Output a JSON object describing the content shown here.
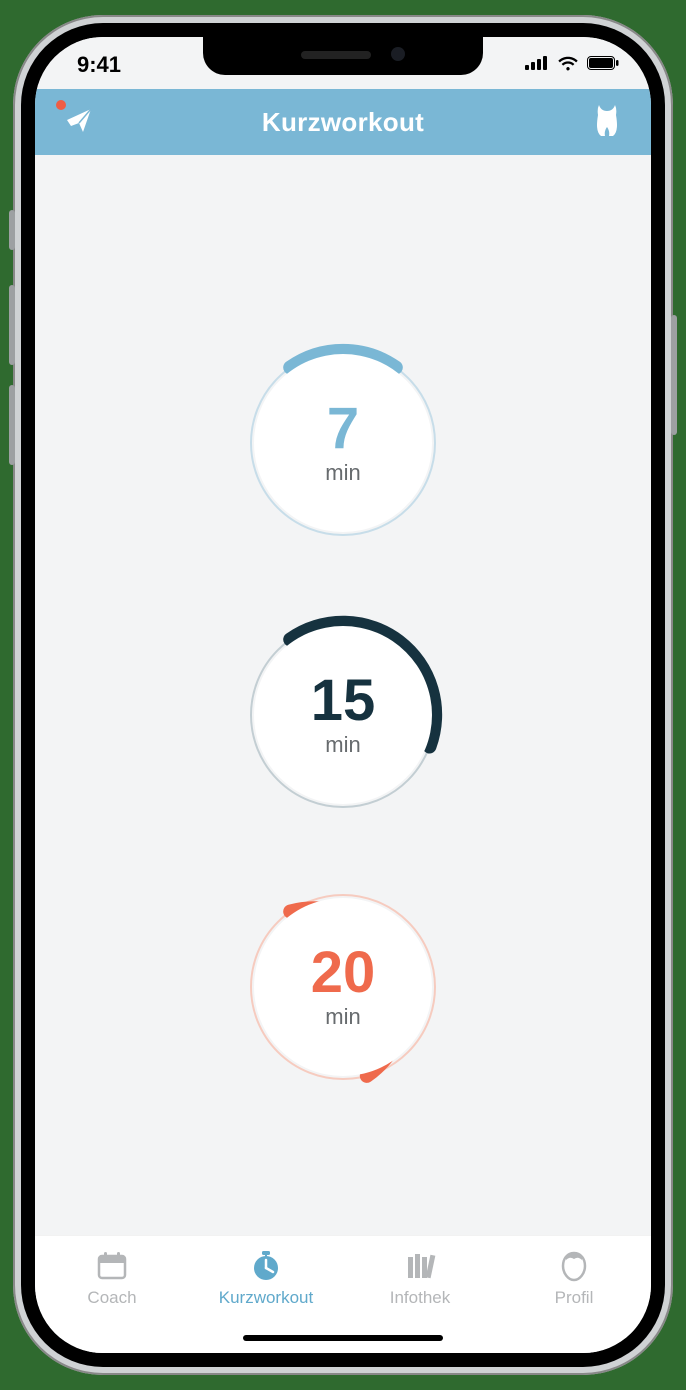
{
  "status": {
    "time": "9:41"
  },
  "header": {
    "title": "Kurzworkout",
    "left_icon": "paper-plane-icon",
    "right_icon": "torso-icon"
  },
  "workouts": [
    {
      "id": "w7",
      "value": "7",
      "unit": "min",
      "color": "#7ab7d5",
      "progress_deg_start": -35,
      "progress_deg_end": 35
    },
    {
      "id": "w15",
      "value": "15",
      "unit": "min",
      "color": "#16323f",
      "progress_deg_start": -35,
      "progress_deg_end": 110
    },
    {
      "id": "w20",
      "value": "20",
      "unit": "min",
      "color": "#ef6a4c",
      "progress_deg_start": -35,
      "progress_deg_end": 165
    }
  ],
  "tabs": [
    {
      "id": "coach",
      "label": "Coach",
      "icon": "calendar-icon",
      "active": false
    },
    {
      "id": "kurzworkout",
      "label": "Kurzworkout",
      "icon": "stopwatch-icon",
      "active": true
    },
    {
      "id": "infothek",
      "label": "Infothek",
      "icon": "library-icon",
      "active": false
    },
    {
      "id": "profil",
      "label": "Profil",
      "icon": "profile-icon",
      "active": false
    }
  ]
}
